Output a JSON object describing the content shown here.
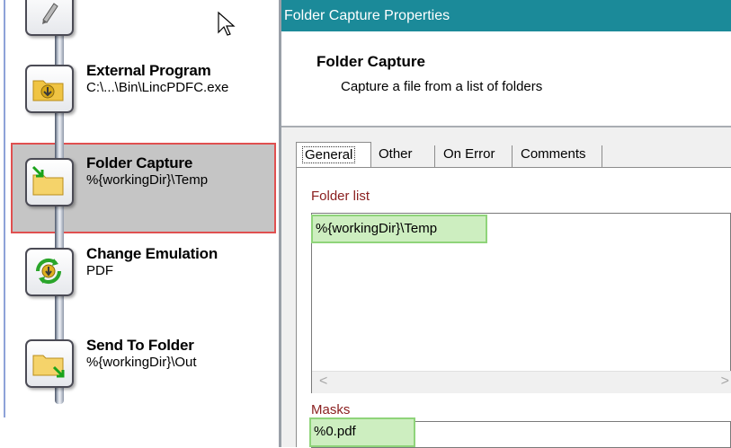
{
  "workflow": {
    "steps": [
      {
        "id": "top",
        "title": "",
        "subtitle": "",
        "icon": "pen-icon"
      },
      {
        "id": "external",
        "title": "External Program",
        "subtitle": "C:\\...\\Bin\\LincPDFC.exe",
        "icon": "folder-download-icon"
      },
      {
        "id": "folder-capture",
        "title": "Folder Capture",
        "subtitle": "%{workingDir}\\Temp",
        "icon": "folder-capture-icon",
        "selected": true
      },
      {
        "id": "change-emulation",
        "title": "Change Emulation",
        "subtitle": "PDF",
        "icon": "emulation-cycle-icon"
      },
      {
        "id": "send-to-folder",
        "title": "Send To Folder",
        "subtitle": "%{workingDir}\\Out",
        "icon": "folder-send-icon"
      }
    ]
  },
  "properties": {
    "window_title": "Folder Capture Properties",
    "header_name": "Folder Capture",
    "header_desc": "Capture a file from a list of folders",
    "tabs": [
      "General",
      "Other",
      "On Error",
      "Comments"
    ],
    "active_tab": "General",
    "folder_list_label": "Folder list",
    "folder_list_items": [
      "%{workingDir}\\Temp"
    ],
    "scroll_left": "<",
    "scroll_right": ">",
    "masks_label": "Masks",
    "masks_value": "%0.pdf"
  },
  "colors": {
    "titlebar": "#1b8a99",
    "field_label": "#8b2020",
    "selection_border": "#e05050",
    "highlight": "#cdeec0"
  }
}
